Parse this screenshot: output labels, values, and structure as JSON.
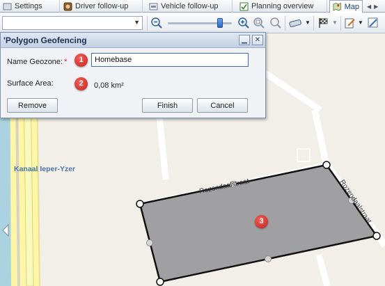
{
  "tabs": [
    {
      "label": "Settings",
      "icon": "settings-icon"
    },
    {
      "label": "Driver follow-up",
      "icon": "driver-icon"
    },
    {
      "label": "Vehicle follow-up",
      "icon": "vehicle-icon"
    },
    {
      "label": "Planning overview",
      "icon": "planning-icon"
    },
    {
      "label": "Map",
      "icon": "map-icon"
    }
  ],
  "toolbar": {
    "address_value": "",
    "zoom_level": 0.84
  },
  "dialog": {
    "title": "'Polygon Geofencing",
    "name_label": "Name Geozone:",
    "required_mark": "*",
    "name_value": "Homebase",
    "surface_label": "Surface Area:",
    "surface_value": "0,08 km²",
    "remove_label": "Remove",
    "finish_label": "Finish",
    "cancel_label": "Cancel",
    "minimize_glyph": "▁",
    "close_glyph": "✕"
  },
  "map": {
    "canal_label": "Kanaal Ieper-Yzer",
    "street1": "Rozendaalstraat",
    "street2": "Rozendaalstraat"
  },
  "callouts": [
    "1",
    "2",
    "3"
  ],
  "colors": {
    "accent": "#2f6ac2",
    "polygon_fill": "#a09fa2",
    "callout": "#d2302a",
    "canal": "#aad3df",
    "canal_band": "#fdf6a6"
  }
}
